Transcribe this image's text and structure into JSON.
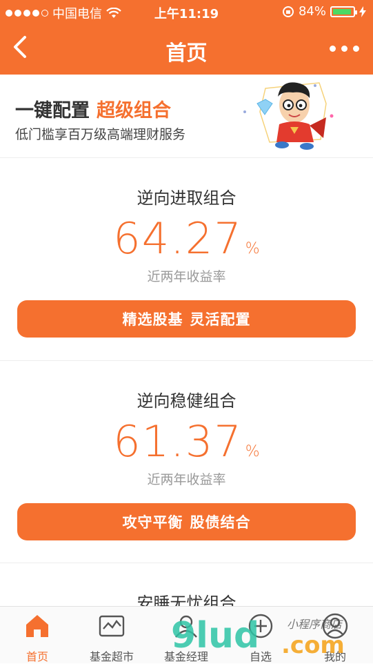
{
  "status_bar": {
    "carrier": "中国电信",
    "time": "上午11:19",
    "battery": "84%"
  },
  "nav": {
    "title": "首页"
  },
  "banner": {
    "title": "一键配置",
    "title_accent": "超级组合",
    "subtitle": "低门槛享百万级高端理财服务"
  },
  "portfolios": [
    {
      "name": "逆向进取组合",
      "rate": "64.27",
      "unit": "%",
      "rate_label": "近两年收益率",
      "button_part1": "精选股基",
      "button_part2": "灵活配置"
    },
    {
      "name": "逆向稳健组合",
      "rate": "61.37",
      "unit": "%",
      "rate_label": "近两年收益率",
      "button_part1": "攻守平衡",
      "button_part2": "股债结合"
    },
    {
      "name": "安睡无忧组合"
    }
  ],
  "tabs": [
    {
      "label": "首页",
      "icon": "home-icon",
      "active": true
    },
    {
      "label": "基金超市",
      "icon": "chart-icon",
      "active": false
    },
    {
      "label": "基金经理",
      "icon": "manager-icon",
      "active": false
    },
    {
      "label": "自选",
      "icon": "plus-circle-icon",
      "active": false
    },
    {
      "label": "我的",
      "icon": "user-icon",
      "active": false
    }
  ],
  "watermark": {
    "text": "小程序商店",
    "brand": "9lud.com"
  },
  "colors": {
    "accent": "#f5702f",
    "battery": "#4cd964"
  }
}
